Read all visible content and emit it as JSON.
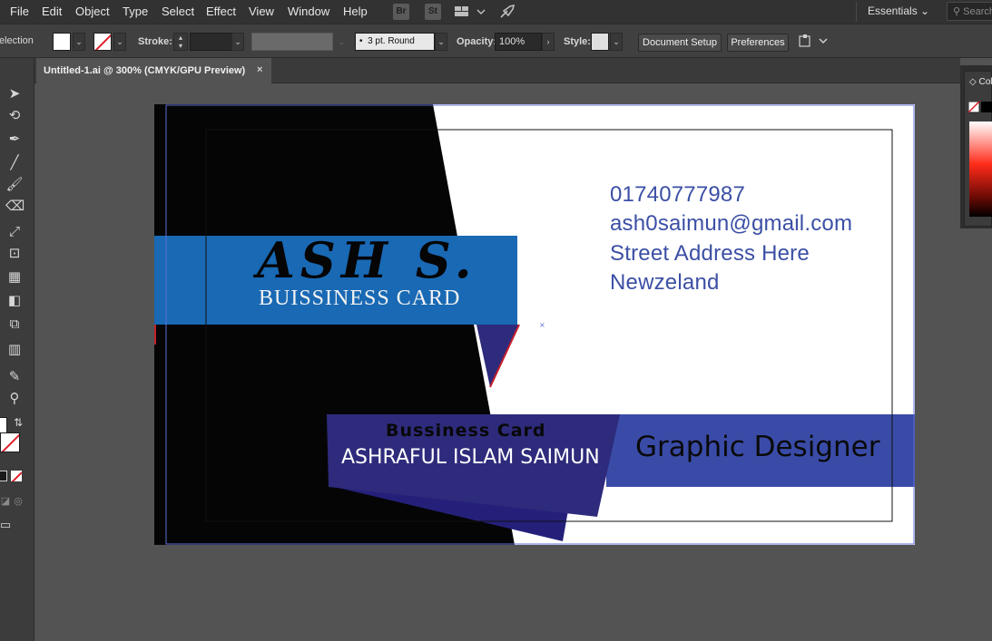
{
  "menubar": {
    "items": [
      "File",
      "Edit",
      "Object",
      "Type",
      "Select",
      "Effect",
      "View",
      "Window",
      "Help"
    ],
    "bridge_label": "Br",
    "stock_label": "St",
    "workspace": "Essentials",
    "search_placeholder": "Search"
  },
  "control": {
    "selection_label": "election",
    "stroke_label": "Stroke:",
    "brush_value": "3 pt. Round",
    "opacity_label": "Opacity:",
    "opacity_value": "100%",
    "style_label": "Style:",
    "doc_setup_label": "Document Setup",
    "preferences_label": "Preferences"
  },
  "tab": {
    "title": "Untitled-1.ai @ 300% (CMYK/GPU Preview)",
    "close": "×"
  },
  "color_panel": {
    "title": "Color"
  },
  "card": {
    "phone": "01740777987",
    "email": "ash0saimun@gmail.com",
    "street": "Street Address Here",
    "country": "Newzeland",
    "logo": "ASH S.",
    "subtitle": "BUISSINESS CARD",
    "biz_label": "Bussiness Card",
    "name": "ASHRAFUL ISLAM SAIMUN",
    "role": "Graphic Designer",
    "colors": {
      "black": "#050505",
      "blue_band": "#1969b4",
      "navy": "#2e2b7c",
      "indigo": "#3a4ba7",
      "accent_red": "#c41e2a",
      "contact_text": "#3b4fa5"
    }
  }
}
